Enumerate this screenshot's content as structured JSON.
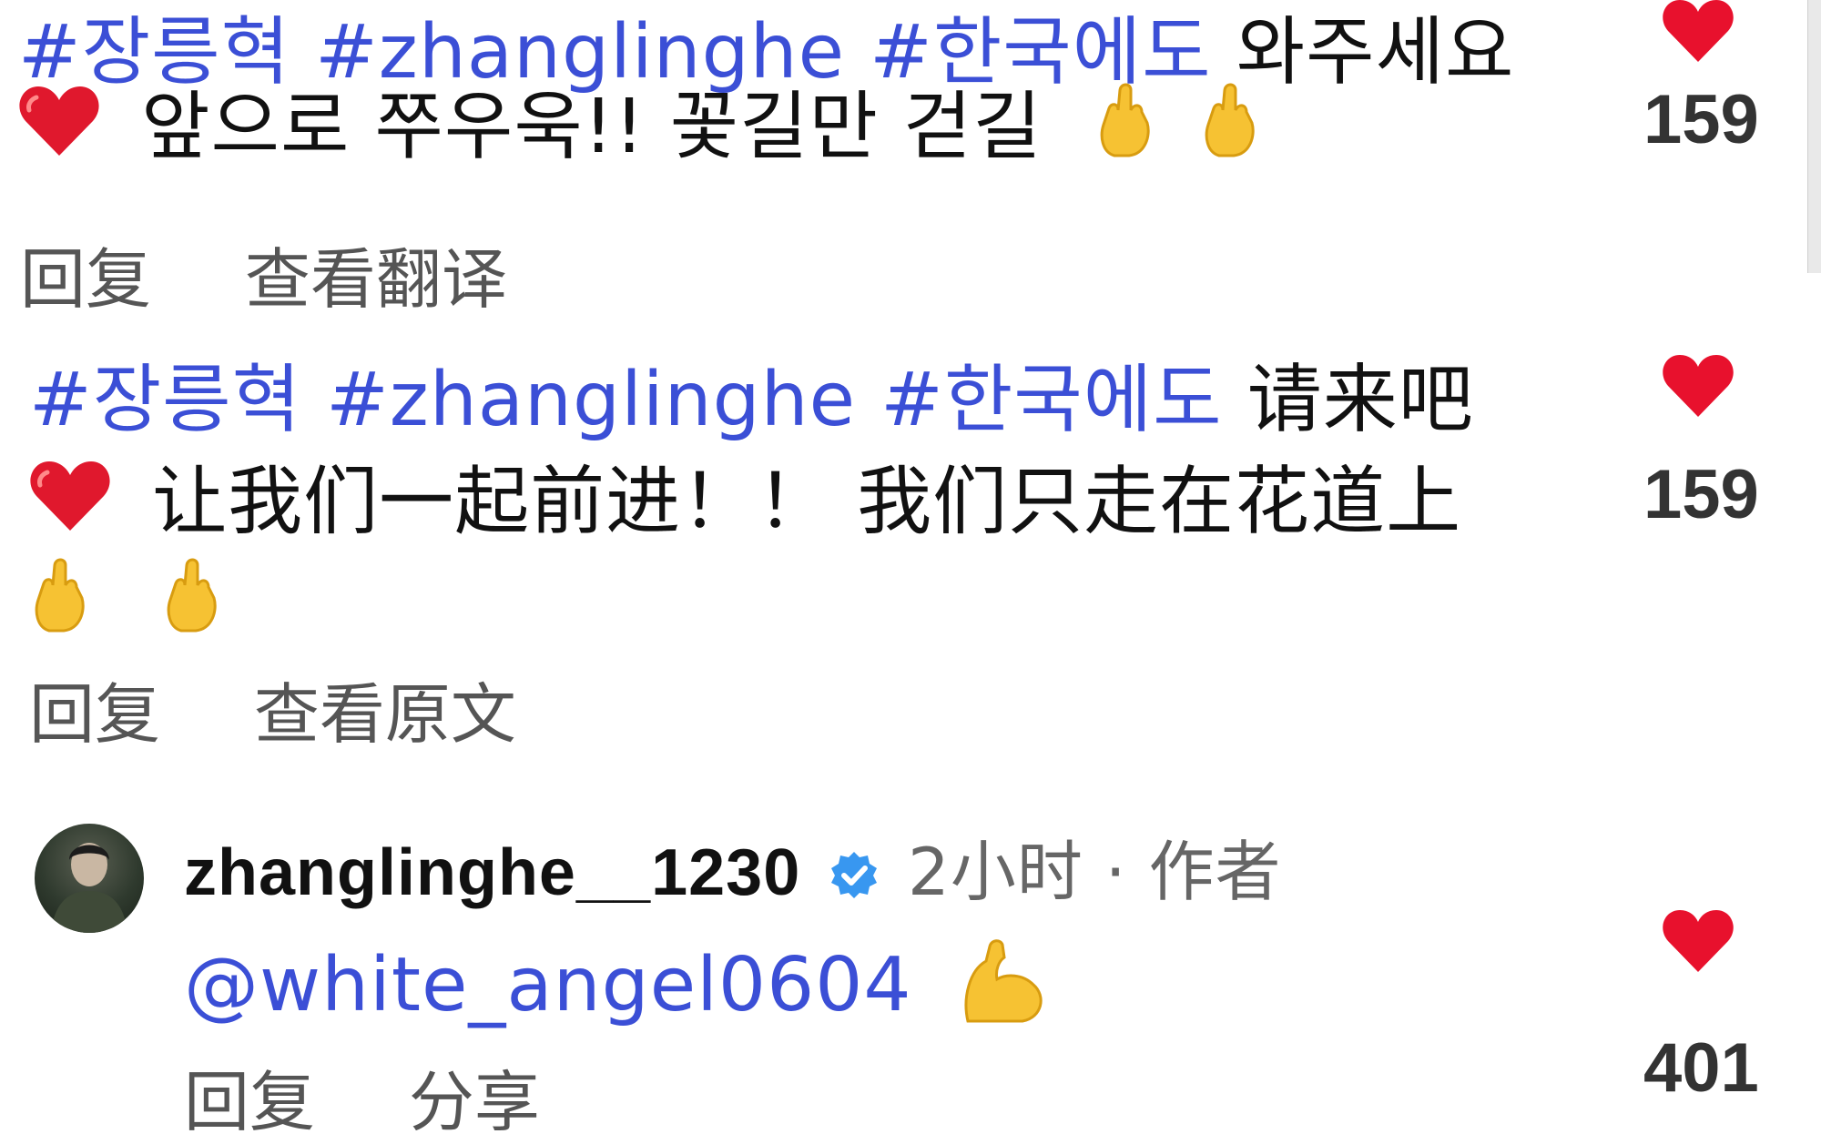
{
  "comments": [
    {
      "tags": "#장릉혁 #zhanglinghe #한국에도",
      "text_line1": "와주세요",
      "text_line2": "앞으로 쭈우욱!! 꽃길만 걷길",
      "actions": [
        "回复",
        "查看翻译"
      ],
      "likes": "159"
    },
    {
      "tags": "#장릉혁 #zhanglinghe #한국에도",
      "text_line1": "请来吧",
      "text_line2": "让我们一起前进！！ 我们只走在花道上",
      "actions": [
        "回复",
        "查看原文"
      ],
      "likes": "159"
    }
  ],
  "reply": {
    "username": "zhanglinghe__1230",
    "meta": "2小时 · 作者",
    "mention": "@white_angel0604",
    "actions": [
      "回复",
      "分享"
    ],
    "likes": "401"
  },
  "icons": {
    "heart_color": "#e8112d",
    "verified_color": "#3897f0",
    "emoji_skin": "#f6c233"
  }
}
